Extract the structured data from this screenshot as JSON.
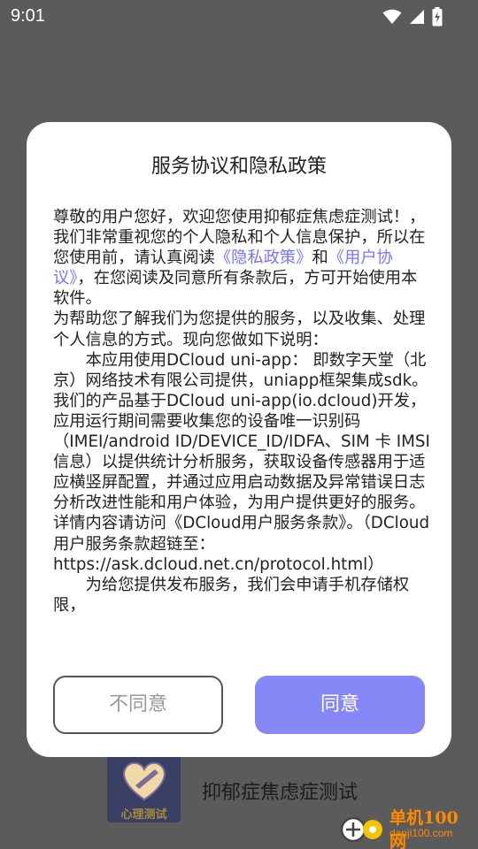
{
  "status_bar": {
    "time": "9:01",
    "icons": [
      "wifi-icon",
      "signal-icon",
      "battery-charging-icon"
    ]
  },
  "background": {
    "app_name": "抑郁症焦虑症测试",
    "logo_text": "心理测试",
    "watermark_title": "单机100网",
    "watermark_url": "danji100.com"
  },
  "dialog": {
    "title": "服务协议和隐私政策",
    "para1_before": "尊敬的用户您好，欢迎您使用抑郁症焦虑症测试！，我们非常重视您的个人隐私和个人信息保护，所以在您使用前，请认真阅读",
    "privacy_link": "《隐私政策》",
    "and_text": "和",
    "terms_link": "《用户协议》",
    "para1_after": "，在您阅读及同意所有条款后，方可开始使用本软件。",
    "para2": "为帮助您了解我们为您提供的服务，以及收集、处理个人信息的方式。现向您做如下说明：",
    "para3": "本应用使用DCloud uni-app： 即数字天堂（北京）网络技术有限公司提供，uniapp框架集成sdk。我们的产品基于DCloud uni-app(io.dcloud)开发，应用运行期间需要收集您的设备唯一识别码（IMEI/android ID/DEVICE_ID/IDFA、SIM 卡 IMSI 信息）以提供统计分析服务，获取设备传感器用于适应横竖屏配置，并通过应用启动数据及异常错误日志分析改进性能和用户体验，为用户提供更好的服务。详情内容请访问《DCloud用户服务条款》。（DCloud用户服务条款超链至：https://ask.dcloud.net.cn/protocol.html）",
    "para4": "为给您提供发布服务，我们会申请手机存储权限，",
    "disagree_label": "不同意",
    "agree_label": "同意"
  },
  "colors": {
    "link": "#7676ff",
    "agree_button": "#8788f7",
    "overlay": "#5b5b5b"
  }
}
